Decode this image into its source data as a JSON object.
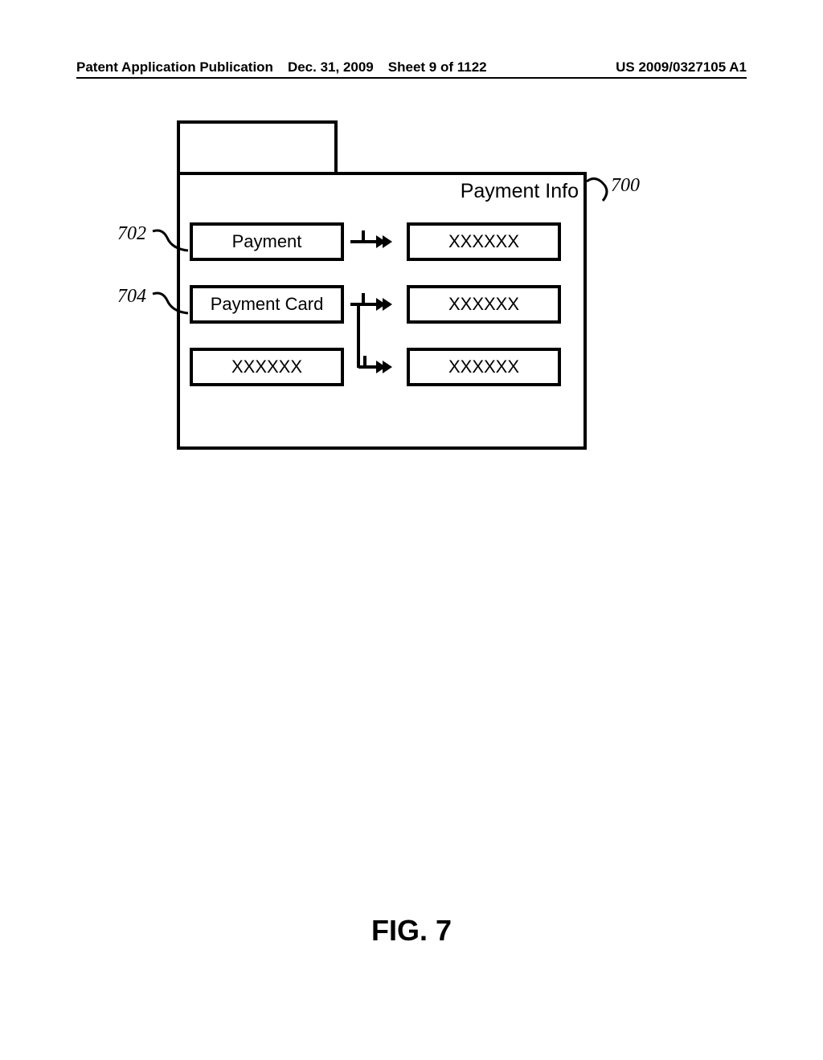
{
  "header": {
    "publication_type": "Patent Application Publication",
    "date": "Dec. 31, 2009",
    "sheet": "Sheet 9 of 1122",
    "pub_number": "US 2009/0327105 A1"
  },
  "diagram": {
    "title": "Payment Info",
    "rows": [
      {
        "left": "Payment",
        "right": "XXXXXX"
      },
      {
        "left": "Payment Card",
        "right": "XXXXXX"
      },
      {
        "left": "XXXXXX",
        "right": "XXXXXX"
      }
    ],
    "callouts": {
      "main": "700",
      "row1": "702",
      "row2": "704"
    }
  },
  "figure_label": "FIG. 7"
}
